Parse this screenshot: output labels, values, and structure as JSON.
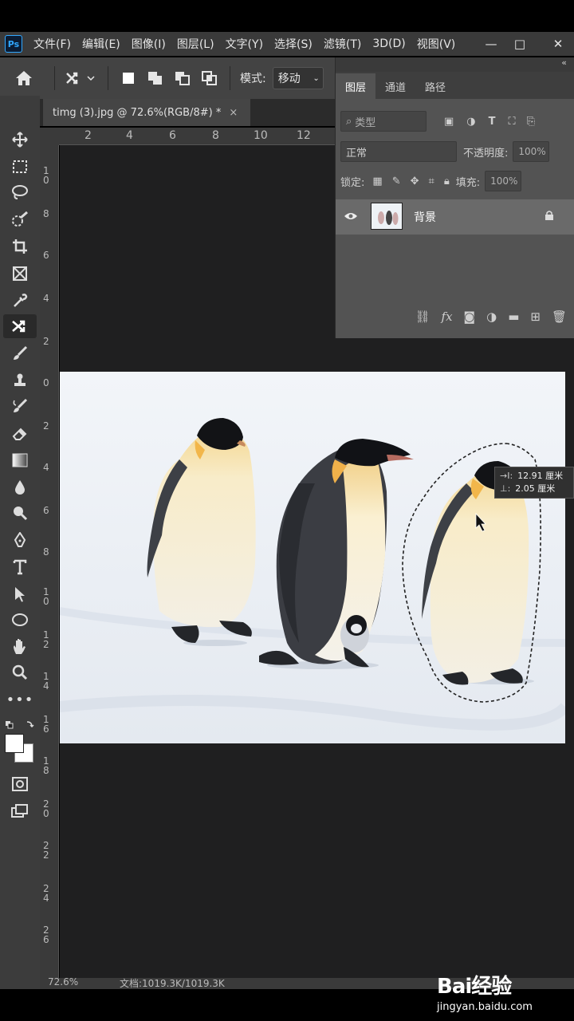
{
  "app": {
    "logo_text": "Ps",
    "menu": [
      "文件(F)",
      "编辑(E)",
      "图像(I)",
      "图层(L)",
      "文字(Y)",
      "选择(S)",
      "滤镜(T)",
      "3D(D)",
      "视图(V)"
    ],
    "window_controls": [
      "—",
      "□",
      "✕"
    ]
  },
  "options_bar": {
    "mode_label": "模式:",
    "mode_value": "移动"
  },
  "document": {
    "tab_title": "timg (3).jpg @ 72.6%(RGB/8#) *",
    "close_symbol": "×",
    "h_ruler_ticks": [
      "2",
      "4",
      "6",
      "8",
      "10",
      "12"
    ],
    "v_ruler_ticks": [
      "1\n0",
      "8",
      "6",
      "4",
      "2",
      "0",
      "2",
      "4",
      "6",
      "8",
      "1\n0",
      "1\n2",
      "1\n4",
      "1\n6",
      "1\n8",
      "2\n0",
      "2\n2",
      "2\n4",
      "2\n6"
    ]
  },
  "measure": {
    "line1": "12.91 厘米",
    "line2": "2.05 厘米"
  },
  "layers_panel": {
    "tabs": [
      "图层",
      "通道",
      "路径"
    ],
    "filter_placeholder": "类型",
    "blend_mode": "正常",
    "opacity_label": "不透明度:",
    "opacity_value": "100%",
    "lock_label": "锁定:",
    "fill_label": "填充:",
    "fill_value": "100%",
    "layer_name": "背景"
  },
  "status_bar": {
    "zoom": "72.6%",
    "doc_info": "文档:1019.3K/1019.3K"
  },
  "watermark": {
    "logo": "Bai经验",
    "site": "jingyan.baidu.com"
  },
  "colors": {
    "menu_bg": "#3a3a3a",
    "panel_bg": "#535353",
    "canvas_bg": "#1f1f20",
    "ps_blue": "#31a8ff"
  }
}
